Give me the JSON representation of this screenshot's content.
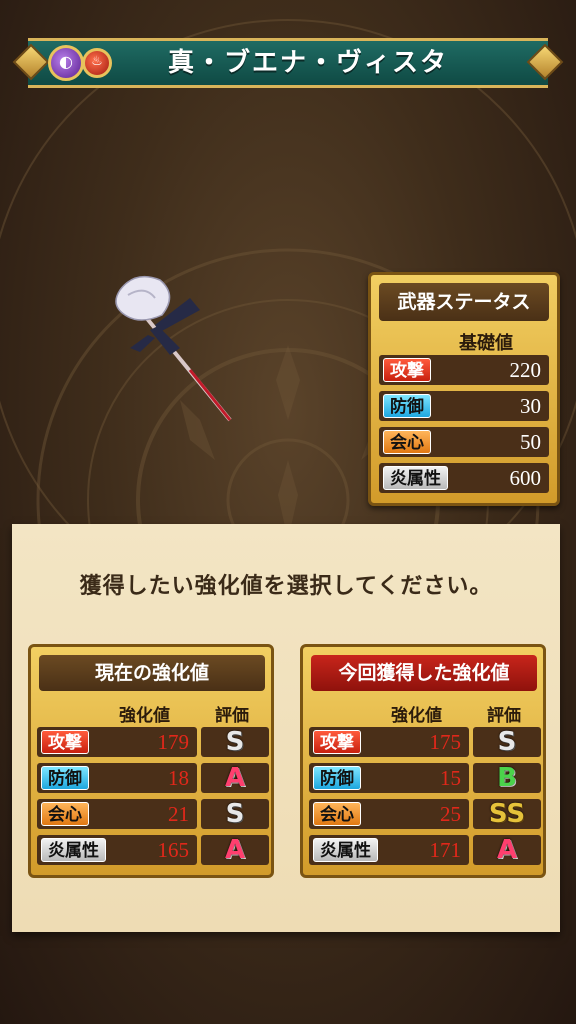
{
  "title": "真・ブエナ・ヴィスタ",
  "icons": {
    "element1": "dark-element-icon",
    "element2": "fire-element-icon"
  },
  "status": {
    "header": "武器ステータス",
    "sub": "基礎値",
    "rows": [
      {
        "label": "攻撃",
        "value": "220"
      },
      {
        "label": "防御",
        "value": "30"
      },
      {
        "label": "会心",
        "value": "50"
      },
      {
        "label": "炎属性",
        "value": "600"
      }
    ]
  },
  "prompt": "獲得したい強化値を選択してください。",
  "current": {
    "header": "現在の強化値",
    "col_value": "強化値",
    "col_grade": "評価",
    "rows": [
      {
        "label": "攻撃",
        "value": "179",
        "grade": "S"
      },
      {
        "label": "防御",
        "value": "18",
        "grade": "A"
      },
      {
        "label": "会心",
        "value": "21",
        "grade": "S"
      },
      {
        "label": "炎属性",
        "value": "165",
        "grade": "A"
      }
    ]
  },
  "acquired": {
    "header": "今回獲得した強化値",
    "col_value": "強化値",
    "col_grade": "評価",
    "rows": [
      {
        "label": "攻撃",
        "value": "175",
        "grade": "S"
      },
      {
        "label": "防御",
        "value": "15",
        "grade": "B"
      },
      {
        "label": "会心",
        "value": "25",
        "grade": "SS"
      },
      {
        "label": "炎属性",
        "value": "171",
        "grade": "A"
      }
    ]
  },
  "colors": {
    "banner": "#1f6b63",
    "gold": "#d9b45a",
    "acquired_header": "#c8251b"
  }
}
